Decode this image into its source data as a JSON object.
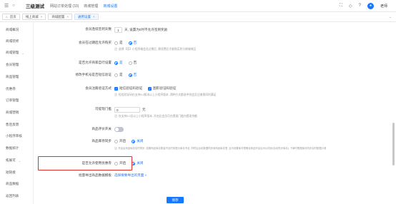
{
  "topbar": {
    "brand": "三级测试",
    "nav": [
      "网站订单处理 (33)",
      "商城管理",
      "商城设置"
    ],
    "active_nav_index": 2,
    "user": "老师"
  },
  "tabs": [
    {
      "label": "首页",
      "active": false
    },
    {
      "label": "线上商城",
      "active": false
    },
    {
      "label": "商城配置",
      "active": false
    },
    {
      "label": "通用设置",
      "active": true
    }
  ],
  "sidebar": {
    "items": [
      {
        "label": "商城概况"
      },
      {
        "label": "商城装修"
      },
      {
        "label": "商城管理",
        "expandable": true
      },
      {
        "label": "会员管理"
      },
      {
        "label": "商品管理"
      },
      {
        "label": "优惠券"
      },
      {
        "label": "订单管理"
      },
      {
        "label": "商城营销"
      },
      {
        "label": "售后反馈"
      },
      {
        "label": "小程序审核"
      },
      {
        "label": "数据统计"
      },
      {
        "label": "拓展可",
        "expandable": true
      },
      {
        "label": "短链接"
      },
      {
        "label": "商品数据"
      },
      {
        "label": "返回列表"
      }
    ]
  },
  "settings": {
    "row1": {
      "label": "会员连续签到天数",
      "value": "1",
      "suffix": "天, 设置为0时不允许签到奖励"
    },
    "row2": {
      "label": "会员在过期后允许购买",
      "yes": "是",
      "no": "否",
      "hint": "注: 选择【否】小程序端会员过期后, 需续费后才能购买积分商城商品"
    },
    "row3": {
      "label": "是否允许商家自行设置",
      "yes": "是",
      "no": "否"
    },
    "row4": {
      "label": "修改手机号是否短信验证",
      "yes": "是",
      "no": "否"
    },
    "row5": {
      "label": "会员注册验证方式",
      "opt1": "短信验证码验证",
      "opt2": "图形验证码验证",
      "hint": "注: 短信验证码在支持3.0版本以上小程序版本, 两种方式都选中则会员注册需同时满足"
    },
    "row6": {
      "label": "可提现门槛",
      "value": "0",
      "suffix": "元",
      "hint": "注: 仅支持3.0及以上小程序版本, 开启后会员可在提现门槛内提现余额"
    },
    "row7": {
      "label": "商品评价开关"
    },
    "row8": {
      "label": "商品库存同步",
      "on": "开启",
      "off": "关闭",
      "hint": "注: 开启后商品库存实时同步, 如果商品库存数量不足时将提示库存不足, 同时后台将数据同步到商品库存里, 且可设置库存预警及商品开启后可以同步(自动同步库存), 下单时根据库存同步实时数据计算"
    },
    "row9": {
      "label": "是否允许使用优惠券",
      "on": "开启",
      "off": "关闭"
    },
    "row10": {
      "label": "批量导出商品数据模板",
      "link": "选择要要导出的页面 »"
    }
  },
  "save_label": "保存"
}
